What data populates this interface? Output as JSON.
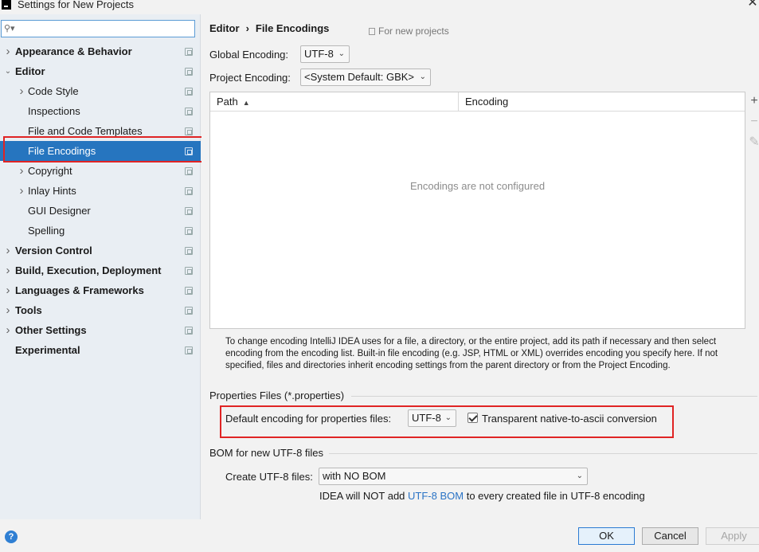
{
  "window": {
    "title": "Settings for New Projects",
    "close_icon": "close-icon"
  },
  "search": {
    "placeholder": "",
    "value": ""
  },
  "sidebar": {
    "items": [
      {
        "label": "Appearance & Behavior",
        "bold": true,
        "chevron": true,
        "indent": 0
      },
      {
        "label": "Editor",
        "bold": true,
        "chevron": "down",
        "indent": 0
      },
      {
        "label": "Code Style",
        "bold": false,
        "chevron": true,
        "indent": 1
      },
      {
        "label": "Inspections",
        "bold": false,
        "chevron": false,
        "indent": 1
      },
      {
        "label": "File and Code Templates",
        "bold": false,
        "chevron": false,
        "indent": 1
      },
      {
        "label": "File Encodings",
        "bold": false,
        "chevron": false,
        "indent": 1,
        "selected": true
      },
      {
        "label": "Copyright",
        "bold": false,
        "chevron": true,
        "indent": 1
      },
      {
        "label": "Inlay Hints",
        "bold": false,
        "chevron": true,
        "indent": 1
      },
      {
        "label": "GUI Designer",
        "bold": false,
        "chevron": false,
        "indent": 1
      },
      {
        "label": "Spelling",
        "bold": false,
        "chevron": false,
        "indent": 1
      },
      {
        "label": "Version Control",
        "bold": true,
        "chevron": true,
        "indent": 0
      },
      {
        "label": "Build, Execution, Deployment",
        "bold": true,
        "chevron": true,
        "indent": 0
      },
      {
        "label": "Languages & Frameworks",
        "bold": true,
        "chevron": true,
        "indent": 0
      },
      {
        "label": "Tools",
        "bold": true,
        "chevron": true,
        "indent": 0
      },
      {
        "label": "Other Settings",
        "bold": true,
        "chevron": true,
        "indent": 0
      },
      {
        "label": "Experimental",
        "bold": true,
        "chevron": false,
        "indent": 0
      }
    ]
  },
  "breadcrumb": {
    "parent": "Editor",
    "separator": "›",
    "current": "File Encodings",
    "scope": "For new projects"
  },
  "global_encoding": {
    "label": "Global Encoding:",
    "value": "UTF-8"
  },
  "project_encoding": {
    "label": "Project Encoding:",
    "value": "<System Default: GBK>"
  },
  "table": {
    "columns": [
      "Path",
      "Encoding"
    ],
    "sort_indicator": "▲",
    "empty_text": "Encodings are not configured",
    "tools": {
      "add": "+",
      "remove": "−",
      "edit": "✎"
    }
  },
  "description": "To change encoding IntelliJ IDEA uses for a file, a directory, or the entire project, add its path if necessary and then select encoding from the encoding list. Built-in file encoding (e.g. JSP, HTML or XML) overrides encoding you specify here. If not specified, files and directories inherit encoding settings from the parent directory or from the Project Encoding.",
  "properties": {
    "title": "Properties Files (*.properties)",
    "default_label": "Default encoding for properties files:",
    "default_value": "UTF-8",
    "native_to_ascii_label": "Transparent native-to-ascii conversion",
    "native_to_ascii_checked": true
  },
  "bom": {
    "title": "BOM for new UTF-8 files",
    "create_label": "Create UTF-8 files:",
    "create_value": "with NO BOM",
    "note_before": "IDEA will NOT add ",
    "note_link": "UTF-8 BOM",
    "note_after": " to every created file in UTF-8 encoding"
  },
  "footer": {
    "help": "?",
    "ok": "OK",
    "cancel": "Cancel",
    "apply": "Apply"
  },
  "colors": {
    "selection": "#2675bf",
    "highlight_box": "#e02424",
    "link": "#2a73c5"
  }
}
